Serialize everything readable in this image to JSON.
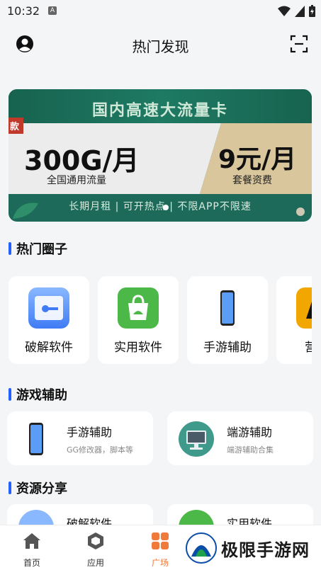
{
  "status_bar": {
    "time": "10:32",
    "a_badge": "A"
  },
  "header": {
    "title": "热门发现"
  },
  "banner": {
    "headline": "国内高速大流量卡",
    "tag": "款",
    "left_big": "300G/月",
    "left_sub": "全国通用流量",
    "right_big": "9元/月",
    "right_sub": "套餐资费",
    "bottom": "长期月租 | 可开热点 | 不限APP不限速"
  },
  "sections": {
    "hot_circles": "热门圈子",
    "game_assist": "游戏辅助",
    "resource_share": "资源分享"
  },
  "circles": [
    {
      "label": "破解软件",
      "icon": "folder-key-icon"
    },
    {
      "label": "实用软件",
      "icon": "shopping-bag-icon"
    },
    {
      "label": "手游辅助",
      "icon": "phone-icon"
    },
    {
      "label": "营养",
      "icon": "app-icon"
    }
  ],
  "game_cards": [
    {
      "title": "手游辅助",
      "desc": "GG修改器，脚本等",
      "icon": "phone-icon"
    },
    {
      "title": "端游辅助",
      "desc": "端游辅助合集",
      "icon": "monitor-icon"
    }
  ],
  "resource_cards": [
    {
      "title": "破解软件",
      "icon": "folder-icon"
    },
    {
      "title": "实用软件",
      "icon": "bag-icon"
    }
  ],
  "nav": [
    {
      "label": "首页",
      "icon": "home-icon"
    },
    {
      "label": "应用",
      "icon": "cube-icon"
    },
    {
      "label": "广场",
      "icon": "grid-icon",
      "active": true
    }
  ],
  "watermark": "极限手游网",
  "colors": {
    "accent": "#2260ff",
    "active_nav": "#f07a3c",
    "banner_green": "#1e6a5a"
  }
}
